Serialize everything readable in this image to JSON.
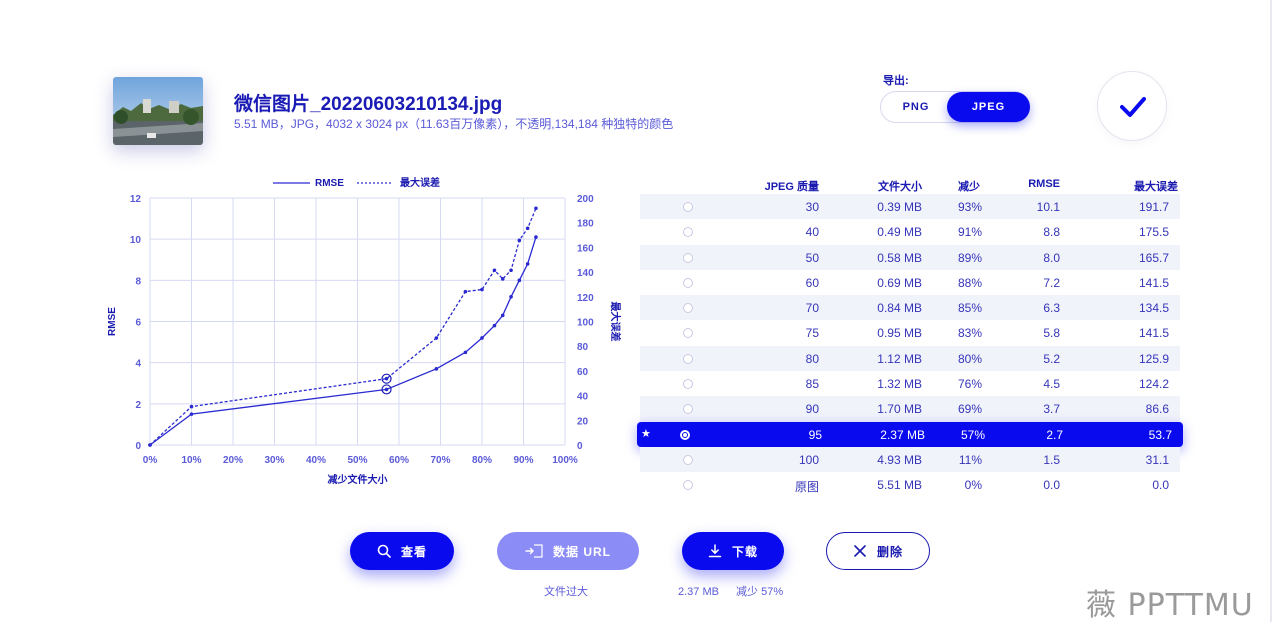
{
  "file": {
    "name": "微信图片_20220603210134.jpg",
    "meta": "5.51 MB，JPG，4032 x 3024 px（11.63百万像素），不透明,134,184 种独特的颜色"
  },
  "export": {
    "label": "导出:",
    "options": [
      "PNG",
      "JPEG"
    ],
    "selected": "JPEG"
  },
  "confirm_icon": "checkmark-icon",
  "chart_data": {
    "type": "line",
    "x": [
      0,
      10,
      57,
      69,
      76,
      80,
      83,
      85,
      87,
      89,
      91,
      93
    ],
    "series": [
      {
        "name": "RMSE",
        "axis": "left",
        "style": "solid",
        "values": [
          0.0,
          1.5,
          2.7,
          3.7,
          4.5,
          5.2,
          5.8,
          6.3,
          7.2,
          8.0,
          8.8,
          10.1
        ]
      },
      {
        "name": "最大误差",
        "axis": "right",
        "style": "dashed",
        "values": [
          0.0,
          31.1,
          53.7,
          86.6,
          124.2,
          125.9,
          141.5,
          134.5,
          141.5,
          165.7,
          175.5,
          191.7
        ]
      }
    ],
    "marked_x": 57,
    "xlabel": "减少文件大小",
    "ylabel_left": "RMSE",
    "ylabel_right": "最大误差",
    "xlim": [
      0,
      100
    ],
    "ylim_left": [
      0,
      12
    ],
    "ylim_right": [
      0,
      200
    ],
    "xticks": [
      "0%",
      "10%",
      "20%",
      "30%",
      "40%",
      "50%",
      "60%",
      "70%",
      "80%",
      "90%",
      "100%"
    ],
    "yticks_left": [
      "0",
      "2",
      "4",
      "6",
      "8",
      "10",
      "12"
    ],
    "yticks_right": [
      "0",
      "20",
      "40",
      "60",
      "80",
      "100",
      "120",
      "140",
      "160",
      "180",
      "200"
    ],
    "legend": [
      "RMSE",
      "最大误差"
    ],
    "legend_position": "top-center",
    "grid": true
  },
  "table": {
    "headers": [
      "JPEG 质量",
      "文件大小",
      "减少",
      "RMSE",
      "最大误差"
    ],
    "rows": [
      {
        "quality": "30",
        "size": "0.39 MB",
        "reduction": "93%",
        "rmse": "10.1",
        "max_err": "191.7"
      },
      {
        "quality": "40",
        "size": "0.49 MB",
        "reduction": "91%",
        "rmse": "8.8",
        "max_err": "175.5"
      },
      {
        "quality": "50",
        "size": "0.58 MB",
        "reduction": "89%",
        "rmse": "8.0",
        "max_err": "165.7"
      },
      {
        "quality": "60",
        "size": "0.69 MB",
        "reduction": "88%",
        "rmse": "7.2",
        "max_err": "141.5"
      },
      {
        "quality": "70",
        "size": "0.84 MB",
        "reduction": "85%",
        "rmse": "6.3",
        "max_err": "134.5"
      },
      {
        "quality": "75",
        "size": "0.95 MB",
        "reduction": "83%",
        "rmse": "5.8",
        "max_err": "141.5"
      },
      {
        "quality": "80",
        "size": "1.12 MB",
        "reduction": "80%",
        "rmse": "5.2",
        "max_err": "125.9"
      },
      {
        "quality": "85",
        "size": "1.32 MB",
        "reduction": "76%",
        "rmse": "4.5",
        "max_err": "124.2"
      },
      {
        "quality": "90",
        "size": "1.70 MB",
        "reduction": "69%",
        "rmse": "3.7",
        "max_err": "86.6"
      },
      {
        "quality": "95",
        "size": "2.37 MB",
        "reduction": "57%",
        "rmse": "2.7",
        "max_err": "53.7",
        "selected": true,
        "star": "★"
      },
      {
        "quality": "100",
        "size": "4.93 MB",
        "reduction": "11%",
        "rmse": "1.5",
        "max_err": "31.1"
      },
      {
        "quality": "原图",
        "size": "5.51 MB",
        "reduction": "0%",
        "rmse": "0.0",
        "max_err": "0.0"
      }
    ]
  },
  "actions": {
    "view": "查看",
    "data_url": "数据 URL",
    "download": "下载",
    "delete": "删除"
  },
  "data_url_note": "文件过大",
  "download_note": {
    "size": "2.37 MB",
    "reduction": "减少 57%"
  },
  "watermark": "薇 PPTTMU"
}
